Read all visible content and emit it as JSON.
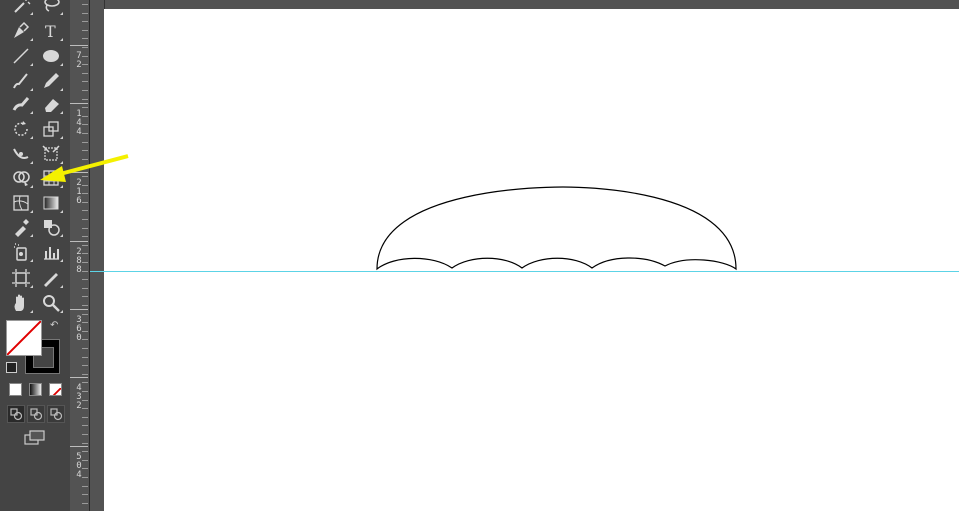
{
  "colors": {
    "panel": "#444444",
    "workspace": "#535353",
    "canvas": "#ffffff",
    "guide": "#5cd3e6",
    "annotation_arrow": "#f4f000"
  },
  "toolbar": {
    "tools": [
      {
        "name": "magic-wand-icon"
      },
      {
        "name": "lasso-icon"
      },
      {
        "name": "pen-icon"
      },
      {
        "name": "type-icon",
        "glyph": "T"
      },
      {
        "name": "line-segment-icon"
      },
      {
        "name": "ellipse-icon"
      },
      {
        "name": "paintbrush-icon"
      },
      {
        "name": "pencil-icon"
      },
      {
        "name": "blob-brush-icon"
      },
      {
        "name": "eraser-icon"
      },
      {
        "name": "rotate-icon"
      },
      {
        "name": "scale-icon"
      },
      {
        "name": "width-icon"
      },
      {
        "name": "free-transform-icon"
      },
      {
        "name": "shape-builder-icon"
      },
      {
        "name": "perspective-grid-icon"
      },
      {
        "name": "mesh-icon"
      },
      {
        "name": "gradient-icon"
      },
      {
        "name": "eyedropper-icon"
      },
      {
        "name": "blend-icon"
      },
      {
        "name": "symbol-sprayer-icon"
      },
      {
        "name": "column-graph-icon"
      },
      {
        "name": "artboard-icon"
      },
      {
        "name": "slice-icon"
      },
      {
        "name": "hand-icon"
      },
      {
        "name": "zoom-icon"
      }
    ],
    "fill_stroke": {
      "fill": "none",
      "stroke": "#000000"
    },
    "color_modes": [
      "color-mode-icon",
      "gradient-mode-icon",
      "none-mode-icon"
    ],
    "draw_modes": [
      "draw-normal-icon",
      "draw-behind-icon",
      "draw-inside-icon"
    ],
    "screen_mode": "screen-mode-icon"
  },
  "ruler": {
    "labels": [
      "72",
      "144",
      "216",
      "288",
      "360",
      "432",
      "504"
    ]
  }
}
